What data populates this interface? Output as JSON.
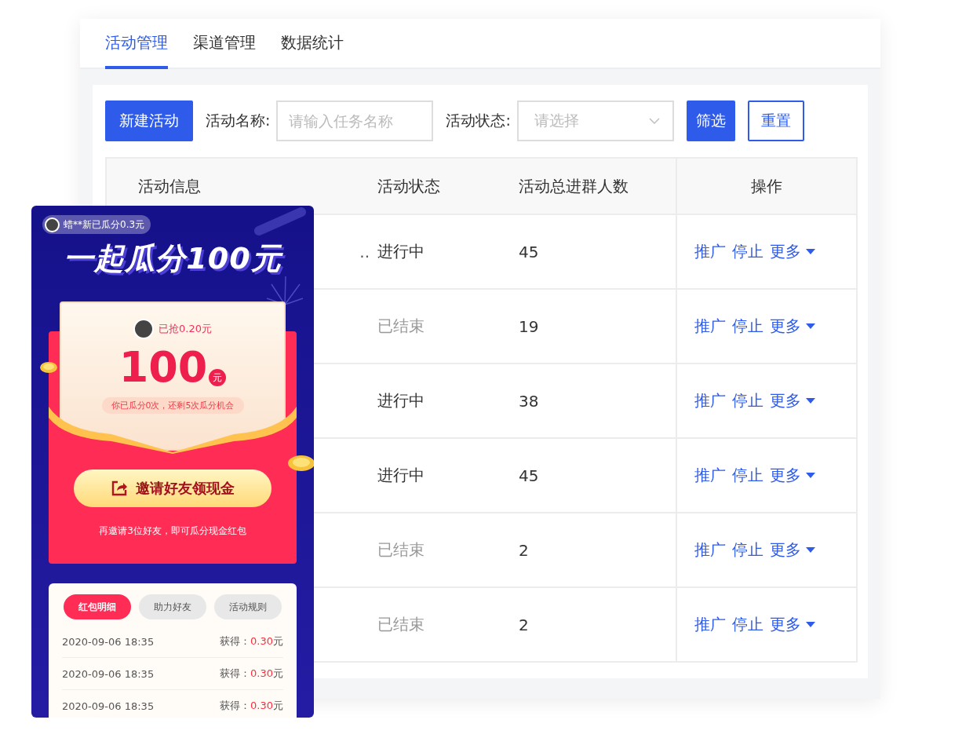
{
  "tabs": [
    {
      "label": "活动管理",
      "selected": true
    },
    {
      "label": "渠道管理",
      "selected": false
    },
    {
      "label": "数据统计",
      "selected": false
    }
  ],
  "toolbar": {
    "new_button": "新建活动",
    "name_label": "活动名称:",
    "name_field": {
      "placeholder": "请输入任务名称"
    },
    "status_label": "活动状态:",
    "status_select": {
      "placeholder": "请选择"
    },
    "filter_button": "筛选",
    "reset_button": "重置"
  },
  "table": {
    "columns": [
      "活动信息",
      "活动状态",
      "活动总进群人数",
      "操作"
    ],
    "rows": [
      {
        "info": "..",
        "status": "进行中",
        "ended": false,
        "count": "45",
        "actions": [
          "推广",
          "停止",
          "更多"
        ]
      },
      {
        "status": "已结束",
        "ended": true,
        "count": "19",
        "actions": [
          "推广",
          "停止",
          "更多"
        ]
      },
      {
        "status": "进行中",
        "ended": false,
        "count": "38",
        "actions": [
          "推广",
          "停止",
          "更多"
        ]
      },
      {
        "status": "进行中",
        "ended": false,
        "count": "45",
        "actions": [
          "推广",
          "停止",
          "更多"
        ]
      },
      {
        "status": "已结束",
        "ended": true,
        "count": "2",
        "actions": [
          "推广",
          "停止",
          "更多"
        ]
      },
      {
        "status": "已结束",
        "ended": true,
        "count": "2",
        "actions": [
          "推广",
          "停止",
          "更多"
        ]
      }
    ]
  },
  "phone": {
    "ticker": "蜡**新已瓜分0.3元",
    "headline": "一起瓜分100元",
    "grabbed": "已抢0.20元",
    "amount": "100",
    "unit": "元",
    "chances": "你已瓜分0次，还剩5次瓜分机会",
    "invite_button": "邀请好友领现金",
    "invite_hint": "再邀请3位好友，即可瓜分现金红包",
    "tabs": [
      {
        "label": "红包明细",
        "selected": true
      },
      {
        "label": "助力好友",
        "selected": false
      },
      {
        "label": "活动规则",
        "selected": false
      }
    ],
    "records": [
      {
        "time": "2020-09-06 18:35",
        "label": "获得：",
        "amount": "0.30",
        "unit": "元"
      },
      {
        "time": "2020-09-06 18:35",
        "label": "获得：",
        "amount": "0.30",
        "unit": "元"
      },
      {
        "time": "2020-09-06 18:35",
        "label": "获得：",
        "amount": "0.30",
        "unit": "元"
      }
    ]
  }
}
